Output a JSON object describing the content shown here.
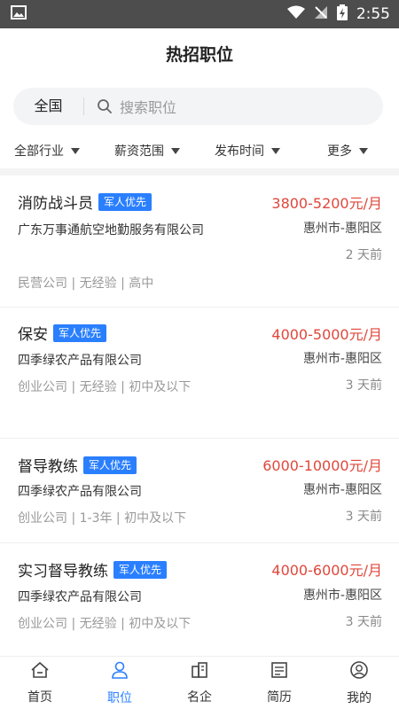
{
  "status": {
    "time": "2:55"
  },
  "header": {
    "title": "热招职位"
  },
  "search": {
    "region": "全国",
    "placeholder": "搜索职位"
  },
  "filters": [
    "全部行业",
    "薪资范围",
    "发布时间",
    "更多"
  ],
  "badge_label": "军人优先",
  "jobs": [
    {
      "title": "消防战斗员",
      "salary": "3800-5200元/月",
      "company": "广东万事通航空地勤服务有限公司",
      "location": "惠州市-惠阳区",
      "posted": "2 天前",
      "tags": "民营公司 | 无经验 | 高中"
    },
    {
      "title": "保安",
      "salary": "4000-5000元/月",
      "company": "四季绿农产品有限公司",
      "location": "惠州市-惠阳区",
      "posted": "3 天前",
      "tags": "创业公司 | 无经验 | 初中及以下"
    },
    {
      "title": "督导教练",
      "salary": "6000-10000元/月",
      "company": "四季绿农产品有限公司",
      "location": "惠州市-惠阳区",
      "posted": "3 天前",
      "tags": "创业公司 | 1-3年 | 初中及以下"
    },
    {
      "title": "实习督导教练",
      "salary": "4000-6000元/月",
      "company": "四季绿农产品有限公司",
      "location": "惠州市-惠阳区",
      "posted": "3 天前",
      "tags": "创业公司 | 无经验 | 初中及以下"
    }
  ],
  "tabs": [
    {
      "label": "首页",
      "icon": "home-icon"
    },
    {
      "label": "职位",
      "icon": "person-icon",
      "active": true
    },
    {
      "label": "名企",
      "icon": "building-icon"
    },
    {
      "label": "简历",
      "icon": "resume-icon"
    },
    {
      "label": "我的",
      "icon": "profile-icon"
    }
  ],
  "colors": {
    "accent": "#2a7fff",
    "salary": "#e0473b",
    "statusbar": "#4d4d4d"
  }
}
